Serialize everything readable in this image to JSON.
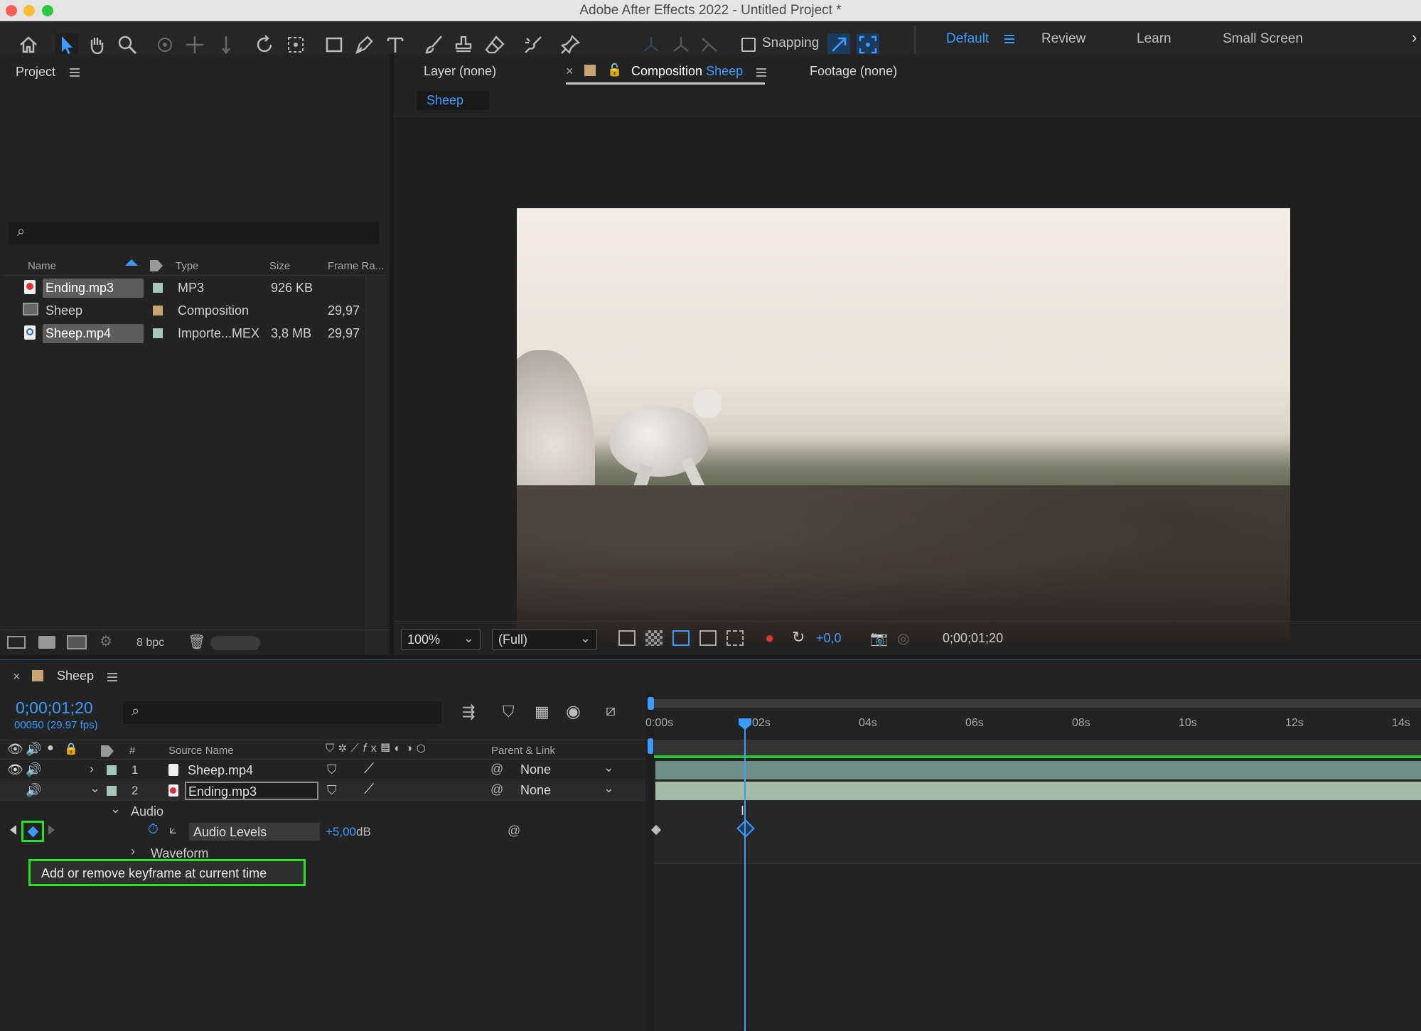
{
  "window": {
    "title": "Adobe After Effects 2022 - Untitled Project *"
  },
  "toolbar": {
    "icons": [
      "home-icon",
      "selection-tool-icon",
      "hand-tool-icon",
      "zoom-tool-icon",
      "orbit-camera-icon",
      "pan-camera-icon",
      "dolly-camera-icon",
      "rotate-tool-icon",
      "pan-behind-icon",
      "rectangle-tool-icon",
      "pen-tool-icon",
      "type-tool-icon",
      "brush-tool-icon",
      "clone-stamp-icon",
      "eraser-icon",
      "roto-brush-icon",
      "puppet-pin-icon"
    ],
    "snapping_label": "Snapping",
    "workspaces": [
      "Default",
      "Review",
      "Learn",
      "Small Screen"
    ],
    "active_workspace": "Default"
  },
  "project": {
    "title": "Project",
    "columns": {
      "name": "Name",
      "type": "Type",
      "size": "Size",
      "frame_rate": "Frame Ra..."
    },
    "items": [
      {
        "name": "Ending.mp3",
        "type": "MP3",
        "size": "926 KB",
        "frame_rate": "",
        "selected": true,
        "swatch": "#a5c7b6"
      },
      {
        "name": "Sheep",
        "type": "Composition",
        "size": "",
        "frame_rate": "29,97",
        "selected": false,
        "swatch": "#c9a471"
      },
      {
        "name": "Sheep.mp4",
        "type": "Importe...MEX",
        "size": "3,8 MB",
        "frame_rate": "29,97",
        "selected": true,
        "swatch": "#a5c7b6"
      }
    ],
    "bpc": "8 bpc"
  },
  "viewer": {
    "tabs": {
      "layer": "Layer (none)",
      "composition_prefix": "Composition",
      "composition_name": "Sheep",
      "footage": "Footage (none)"
    },
    "breadcrumb": "Sheep",
    "zoom": "100%",
    "resolution": "(Full)",
    "exposure": "+0,0",
    "timecode": "0;00;01;20"
  },
  "timeline": {
    "comp_name": "Sheep",
    "current_time": "0;00;01;20",
    "frame_info": "00050 (29.97 fps)",
    "columns": {
      "num": "#",
      "source": "Source Name",
      "parent": "Parent & Link"
    },
    "layers": [
      {
        "num": "1",
        "name": "Sheep.mp4",
        "parent": "None"
      },
      {
        "num": "2",
        "name": "Ending.mp3",
        "parent": "None"
      }
    ],
    "audio_group": "Audio",
    "property": {
      "name": "Audio Levels",
      "value": "+5,00",
      "unit": "dB"
    },
    "waveform": "Waveform",
    "tooltip": "Add or remove keyframe at current time",
    "ruler": [
      "0:00s",
      "02s",
      "04s",
      "06s",
      "08s",
      "10s",
      "12s",
      "14s"
    ]
  }
}
